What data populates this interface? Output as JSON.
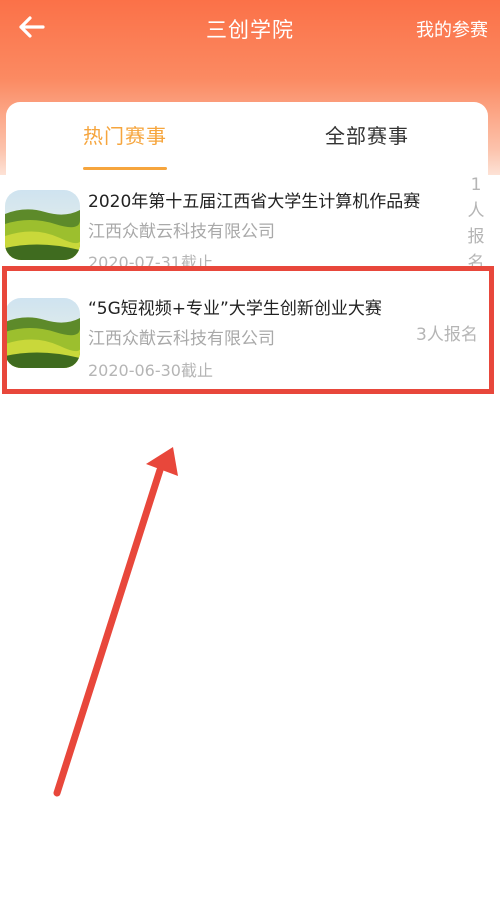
{
  "header": {
    "title": "三创学院",
    "right_action": "我的参赛",
    "back_icon": "arrow-left-icon"
  },
  "tabs": [
    {
      "label": "热门赛事",
      "active": true
    },
    {
      "label": "全部赛事",
      "active": false
    }
  ],
  "competitions": [
    {
      "title": "2020年第十五届江西省大学生计算机作品赛",
      "organizer": "江西众猷云科技有限公司",
      "deadline": "2020-07-31截止",
      "signup": "1人报名",
      "thumbnail": "grassland-landscape-image"
    },
    {
      "title": "“5G短视频+专业”大学生创新创业大赛",
      "organizer": "江西众猷云科技有限公司",
      "deadline": "2020-06-30截止",
      "signup": "3人报名",
      "thumbnail": "grassland-landscape-image"
    }
  ],
  "signup_vertical": [
    "1",
    "人",
    "报",
    "名"
  ],
  "colors": {
    "header_gradient_top": "#fb7148",
    "accent_tab": "#f6a53d",
    "highlight": "#e8473b"
  }
}
